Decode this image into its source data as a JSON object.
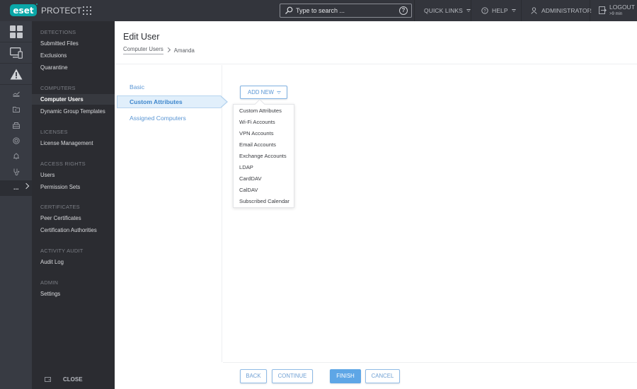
{
  "topbar": {
    "logo_text": "eset",
    "product": "PROTECT",
    "search_placeholder": "Type to search ...",
    "quick_links": "QUICK LINKS",
    "help": "HELP",
    "user": "ADMINISTRATOR",
    "logout": "LOGOUT",
    "logout_timer": ">9 min"
  },
  "rail": {
    "icons": [
      "dashboard-icon",
      "computers-icon",
      "detections-warning-icon",
      "reports-icon",
      "tasks-folder-icon",
      "installers-icon",
      "policies-icon",
      "notifications-icon",
      "status-overview-icon"
    ],
    "more": "..."
  },
  "sidebar": {
    "sections": [
      {
        "heading": "DETECTIONS",
        "items": [
          "Submitted Files",
          "Exclusions",
          "Quarantine"
        ]
      },
      {
        "heading": "COMPUTERS",
        "items": [
          "Computer Users",
          "Dynamic Group Templates"
        ]
      },
      {
        "heading": "LICENSES",
        "items": [
          "License Management"
        ]
      },
      {
        "heading": "ACCESS RIGHTS",
        "items": [
          "Users",
          "Permission Sets"
        ]
      },
      {
        "heading": "CERTIFICATES",
        "items": [
          "Peer Certificates",
          "Certification Authorities"
        ]
      },
      {
        "heading": "ACTIVITY AUDIT",
        "items": [
          "Audit Log"
        ]
      },
      {
        "heading": "ADMIN",
        "items": [
          "Settings"
        ]
      }
    ],
    "active_item": "Computer Users",
    "close_label": "CLOSE"
  },
  "page": {
    "title": "Edit User",
    "breadcrumb": [
      "Computer Users",
      "Amanda"
    ]
  },
  "steps": [
    {
      "label": "Basic",
      "active": false
    },
    {
      "label": "Custom Attributes",
      "active": true
    },
    {
      "label": "Assigned Computers",
      "active": false
    }
  ],
  "add_new": {
    "label": "ADD NEW",
    "options": [
      "Custom Attributes",
      "Wi-Fi Accounts",
      "VPN Accounts",
      "Email Accounts",
      "Exchange Accounts",
      "LDAP",
      "CardDAV",
      "CalDAV",
      "Subscribed Calendar"
    ]
  },
  "footer": {
    "back": "BACK",
    "continue": "CONTINUE",
    "finish": "FINISH",
    "cancel": "CANCEL"
  },
  "colors": {
    "brand": "#0aa7a8",
    "accent": "#5ea6e6",
    "topbar_bg": "#33353c",
    "sidebar_bg": "#2b2c31"
  }
}
